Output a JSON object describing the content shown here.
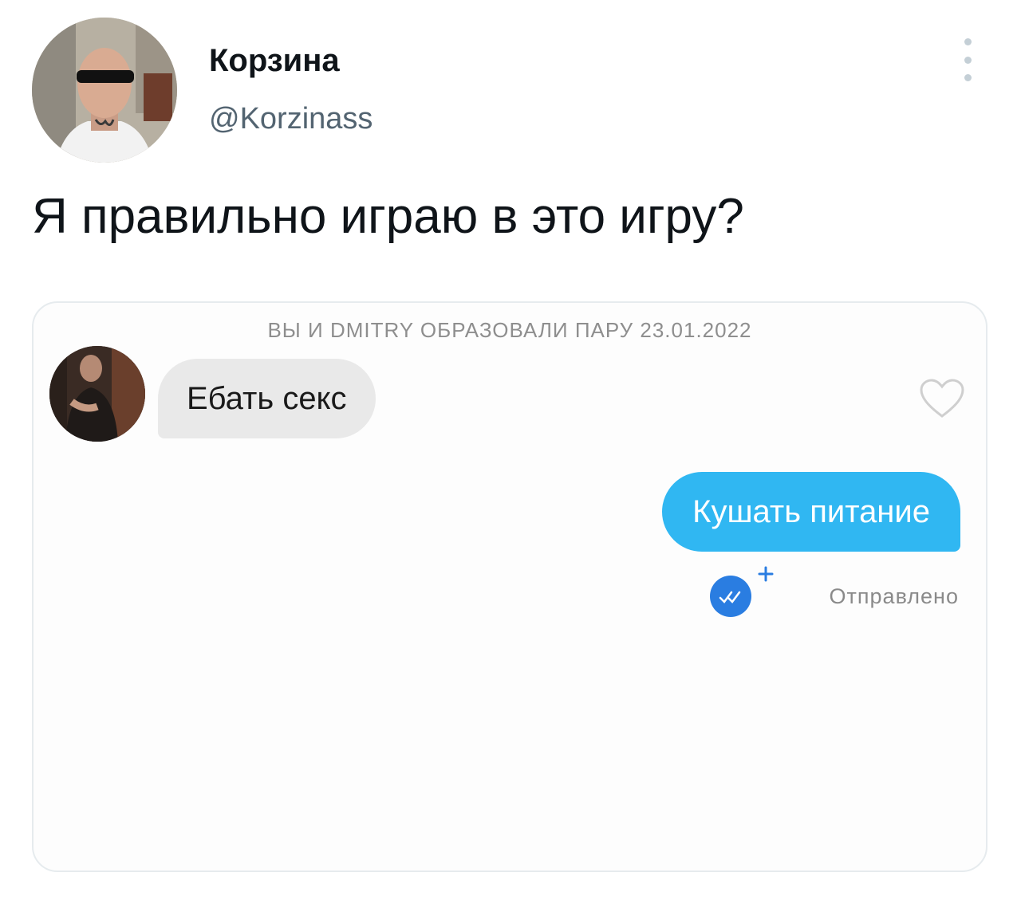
{
  "tweet": {
    "author": {
      "display_name": "Корзина",
      "handle": "@Korzinass",
      "avatar_icon": "profile-photo"
    },
    "more_icon": "vertical-ellipsis-icon",
    "text": "Я правильно играю в это игру?"
  },
  "screenshot": {
    "match_banner": "ВЫ И DMITRY ОБРАЗОВАЛИ ПАРУ 23.01.2022",
    "incoming_message": {
      "text": "Ебать секс",
      "avatar_icon": "match-profile-photo"
    },
    "like_icon": "heart-outline-icon",
    "outgoing_message": {
      "text": "Кушать питание"
    },
    "status": {
      "icon": "double-check-badge-icon",
      "label": "Отправлено"
    }
  },
  "colors": {
    "outgoing_bubble": "#30b7f2",
    "incoming_bubble": "#e9e9e9",
    "check_badge": "#2a7de1",
    "handle_text": "#536471"
  }
}
